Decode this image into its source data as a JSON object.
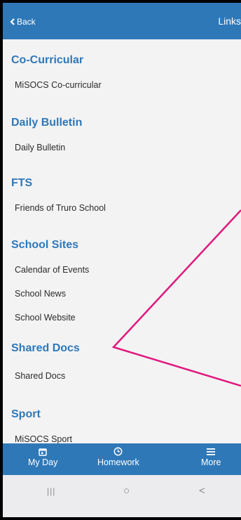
{
  "header": {
    "back_label": "Back",
    "title": "Links"
  },
  "sections": [
    {
      "heading": "Co-Curricular",
      "links": [
        "MiSOCS Co-curricular"
      ]
    },
    {
      "heading": "Daily Bulletin",
      "links": [
        "Daily Bulletin"
      ]
    },
    {
      "heading": "FTS",
      "links": [
        "Friends of Truro School"
      ]
    },
    {
      "heading": "School Sites",
      "links": [
        "Calendar of Events",
        "School News",
        "School Website"
      ]
    },
    {
      "heading": "Shared Docs",
      "links": [
        "Shared Docs"
      ]
    },
    {
      "heading": "Sport",
      "links": [
        "MiSOCS Sport"
      ]
    }
  ],
  "bottom_nav": [
    {
      "label": "My Day",
      "icon": "calendar-icon"
    },
    {
      "label": "Homework",
      "icon": "clock-icon"
    },
    {
      "label": "More",
      "icon": "menu-icon"
    }
  ],
  "system_nav": {
    "recents": "|||",
    "home": "○",
    "back": "<"
  },
  "colors": {
    "brand": "#2f78b8",
    "annotation": "#e0197d",
    "background": "#f3f3f4"
  }
}
